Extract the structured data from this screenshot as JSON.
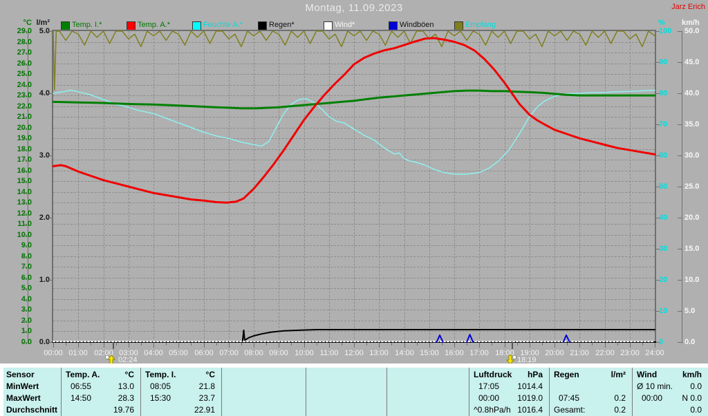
{
  "header": {
    "title": "Montag, 11.09.2023",
    "user": "Jarz Erich"
  },
  "legend": [
    {
      "label": "Temp. I.*",
      "swatch": "#008000",
      "text": "#007800"
    },
    {
      "label": "Temp. A.*",
      "swatch": "#ff0000",
      "text": "#007800"
    },
    {
      "label": "Feuchte A.*",
      "swatch": "#00ffff",
      "text": "#00dede"
    },
    {
      "label": "Regen*",
      "swatch": "#000000",
      "text": "#111111"
    },
    {
      "label": "Wind*",
      "swatch": "#ffffff",
      "text": "#f8f8f8"
    },
    {
      "label": "Windböen",
      "swatch": "#0000d8",
      "text": "#111111"
    },
    {
      "label": "Empfang",
      "swatch": "#7f7f20",
      "text": "#00dede"
    }
  ],
  "x_axis": {
    "labels": [
      "00:00",
      "01:00",
      "02:00",
      "03:00",
      "04:00",
      "05:00",
      "06:00",
      "07:00",
      "08:00",
      "09:00",
      "10:00",
      "11:00",
      "12:00",
      "13:00",
      "14:00",
      "15:00",
      "16:00",
      "17:00",
      "18:00",
      "19:00",
      "20:00",
      "21:00",
      "22:00",
      "23:00",
      "24:00"
    ]
  },
  "markers": [
    {
      "label": "02:24",
      "hour": 2.4,
      "direction": "up"
    },
    {
      "label": "18:19",
      "hour": 18.32,
      "direction": "down"
    }
  ],
  "chart_data": {
    "type": "line",
    "title": "Montag, 11.09.2023",
    "x_unit": "hours",
    "x_range": [
      0,
      24
    ],
    "axes": {
      "temp": {
        "label": "°C",
        "min": 0,
        "max": 29,
        "step": 1,
        "color": "#007800",
        "decimals": 1
      },
      "rain": {
        "label": "l/m²",
        "min": 0,
        "max": 5,
        "step": 1,
        "color": "#1a1a1a",
        "decimals": 1
      },
      "humidity": {
        "label": "%",
        "min": 0,
        "max": 100,
        "step": 10,
        "color": "#00dede",
        "decimals": 0
      },
      "wind": {
        "label": "km/h",
        "min": 0,
        "max": 50,
        "step": 5,
        "color": "#f8f8f8",
        "decimals": 1
      }
    },
    "series": [
      {
        "name": "Empfang",
        "axis": "humidity",
        "color": "#7f7f20",
        "width": 1.5,
        "prefix": [
          [
            0,
            100
          ],
          [
            0.05,
            81
          ],
          [
            0.12,
            100
          ]
        ],
        "sampled": {
          "start": 0.25,
          "step": 0.25,
          "values": [
            100,
            97,
            100,
            99,
            95.5,
            100,
            98,
            100,
            96,
            100,
            100,
            97.5,
            99,
            95,
            100,
            98.5,
            100,
            97,
            100,
            99,
            95.5,
            100,
            98,
            100,
            96,
            100,
            100,
            97.5,
            99,
            95,
            100,
            98.5,
            100,
            97,
            100,
            99,
            95.5,
            100,
            98,
            100,
            96,
            100,
            100,
            97.5,
            99,
            95,
            100,
            98.5,
            100,
            97,
            100,
            99,
            95.5,
            100,
            98,
            100,
            96,
            100,
            100,
            97.5,
            99,
            95,
            100,
            98.5,
            100,
            97,
            100,
            99,
            95.5,
            100,
            98,
            100,
            96,
            100,
            100,
            97.5,
            99,
            95,
            100,
            98.5,
            100,
            97,
            100,
            99,
            95.5,
            100,
            98,
            100,
            96,
            100,
            100,
            97.5,
            99,
            95,
            100,
            98.5
          ]
        }
      },
      {
        "name": "Feuchte A.",
        "axis": "humidity",
        "color": "#8ef2f2",
        "width": 1.5,
        "points": [
          [
            0,
            80
          ],
          [
            0.4,
            80.5
          ],
          [
            0.7,
            81
          ],
          [
            1,
            80.5
          ],
          [
            1.5,
            79.5
          ],
          [
            2,
            78
          ],
          [
            2.5,
            76.5
          ],
          [
            3,
            75.5
          ],
          [
            3.4,
            74.5
          ],
          [
            4,
            73.5
          ],
          [
            4.5,
            72
          ],
          [
            5,
            70.5
          ],
          [
            5.5,
            69
          ],
          [
            6,
            67.5
          ],
          [
            6.5,
            66.3
          ],
          [
            7,
            65.5
          ],
          [
            7.5,
            64.3
          ],
          [
            8,
            63.5
          ],
          [
            8.3,
            63
          ],
          [
            8.6,
            64.5
          ],
          [
            8.9,
            69
          ],
          [
            9.2,
            73.5
          ],
          [
            9.5,
            76.5
          ],
          [
            9.8,
            78
          ],
          [
            10.1,
            78.3
          ],
          [
            10.4,
            77
          ],
          [
            10.7,
            75
          ],
          [
            11,
            72.5
          ],
          [
            11.3,
            71
          ],
          [
            11.6,
            70.5
          ],
          [
            12,
            68.5
          ],
          [
            12.4,
            66.5
          ],
          [
            12.8,
            65
          ],
          [
            13.2,
            62.5
          ],
          [
            13.4,
            61.5
          ],
          [
            13.6,
            60.5
          ],
          [
            13.8,
            60.8
          ],
          [
            14,
            59
          ],
          [
            14.2,
            58.3
          ],
          [
            14.4,
            58
          ],
          [
            14.8,
            57
          ],
          [
            15.2,
            55.5
          ],
          [
            15.6,
            54.5
          ],
          [
            16,
            54
          ],
          [
            16.5,
            54
          ],
          [
            17,
            54.5
          ],
          [
            17.4,
            56
          ],
          [
            17.8,
            58.5
          ],
          [
            18.2,
            62
          ],
          [
            18.6,
            67
          ],
          [
            19,
            72.5
          ],
          [
            19.3,
            75.5
          ],
          [
            19.6,
            77.5
          ],
          [
            20,
            79
          ],
          [
            20.4,
            79.8
          ],
          [
            21,
            80
          ],
          [
            21.5,
            80.2
          ],
          [
            22,
            80.3
          ],
          [
            22.5,
            80.5
          ],
          [
            23,
            80.6
          ],
          [
            23.5,
            80.8
          ],
          [
            24,
            81
          ]
        ]
      },
      {
        "name": "Temp. I.",
        "axis": "temp",
        "color": "#008000",
        "width": 3,
        "points": [
          [
            0,
            22.4
          ],
          [
            1,
            22.35
          ],
          [
            2,
            22.3
          ],
          [
            3,
            22.2
          ],
          [
            4,
            22.15
          ],
          [
            5,
            22.05
          ],
          [
            6,
            21.95
          ],
          [
            6.5,
            21.9
          ],
          [
            7,
            21.85
          ],
          [
            7.5,
            21.8
          ],
          [
            8.1,
            21.8
          ],
          [
            8.6,
            21.85
          ],
          [
            9,
            21.9
          ],
          [
            9.5,
            22.0
          ],
          [
            10,
            22.1
          ],
          [
            10.5,
            22.2
          ],
          [
            11,
            22.3
          ],
          [
            11.5,
            22.4
          ],
          [
            12,
            22.5
          ],
          [
            12.5,
            22.65
          ],
          [
            13,
            22.8
          ],
          [
            13.5,
            22.9
          ],
          [
            14,
            23.0
          ],
          [
            14.5,
            23.1
          ],
          [
            15,
            23.2
          ],
          [
            15.5,
            23.3
          ],
          [
            16,
            23.4
          ],
          [
            16.5,
            23.45
          ],
          [
            17,
            23.45
          ],
          [
            17.5,
            23.4
          ],
          [
            18,
            23.4
          ],
          [
            18.5,
            23.35
          ],
          [
            19,
            23.3
          ],
          [
            19.5,
            23.25
          ],
          [
            20,
            23.15
          ],
          [
            20.5,
            23.05
          ],
          [
            21,
            23.0
          ],
          [
            22,
            23.0
          ],
          [
            23,
            23.0
          ],
          [
            24,
            23.0
          ]
        ]
      },
      {
        "name": "Temp. A.",
        "axis": "temp",
        "color": "#f00000",
        "width": 3,
        "points": [
          [
            0,
            16.4
          ],
          [
            0.3,
            16.5
          ],
          [
            0.5,
            16.4
          ],
          [
            1,
            15.9
          ],
          [
            1.5,
            15.5
          ],
          [
            2,
            15.1
          ],
          [
            2.5,
            14.8
          ],
          [
            3,
            14.5
          ],
          [
            3.5,
            14.2
          ],
          [
            4,
            13.9
          ],
          [
            4.5,
            13.7
          ],
          [
            5,
            13.5
          ],
          [
            5.5,
            13.3
          ],
          [
            6,
            13.2
          ],
          [
            6.5,
            13.05
          ],
          [
            6.92,
            13.0
          ],
          [
            7.3,
            13.1
          ],
          [
            7.6,
            13.4
          ],
          [
            8,
            14.3
          ],
          [
            8.4,
            15.4
          ],
          [
            8.8,
            16.6
          ],
          [
            9.2,
            17.9
          ],
          [
            9.6,
            19.3
          ],
          [
            10,
            20.7
          ],
          [
            10.4,
            21.9
          ],
          [
            10.8,
            23.0
          ],
          [
            11.2,
            24.0
          ],
          [
            11.6,
            24.9
          ],
          [
            12,
            25.9
          ],
          [
            12.4,
            26.5
          ],
          [
            12.8,
            26.9
          ],
          [
            13.2,
            27.2
          ],
          [
            13.6,
            27.4
          ],
          [
            14,
            27.7
          ],
          [
            14.4,
            28.0
          ],
          [
            14.83,
            28.3
          ],
          [
            15.2,
            28.35
          ],
          [
            15.6,
            28.2
          ],
          [
            16,
            28.0
          ],
          [
            16.4,
            27.7
          ],
          [
            16.8,
            27.2
          ],
          [
            17.2,
            26.4
          ],
          [
            17.6,
            25.4
          ],
          [
            18,
            24.2
          ],
          [
            18.3,
            23.2
          ],
          [
            18.6,
            22.2
          ],
          [
            19,
            21.2
          ],
          [
            19.3,
            20.7
          ],
          [
            19.6,
            20.3
          ],
          [
            20,
            19.8
          ],
          [
            20.5,
            19.4
          ],
          [
            21,
            19.0
          ],
          [
            21.5,
            18.7
          ],
          [
            22,
            18.4
          ],
          [
            22.5,
            18.1
          ],
          [
            23,
            17.9
          ],
          [
            23.5,
            17.7
          ],
          [
            24,
            17.5
          ]
        ]
      },
      {
        "name": "Regen",
        "axis": "rain",
        "color": "#000000",
        "width": 2,
        "points": [
          [
            0,
            0
          ],
          [
            7.55,
            0
          ],
          [
            7.6,
            0.19
          ],
          [
            7.64,
            0.03
          ],
          [
            7.8,
            0.07
          ],
          [
            8,
            0.1
          ],
          [
            8.3,
            0.13
          ],
          [
            8.7,
            0.16
          ],
          [
            9.2,
            0.18
          ],
          [
            9.8,
            0.19
          ],
          [
            10.5,
            0.2
          ],
          [
            24,
            0.2
          ]
        ]
      },
      {
        "name": "Wind",
        "axis": "wind",
        "color": "#ffffff",
        "width": 2,
        "dash": "2 3",
        "points": [
          [
            0,
            0.1
          ],
          [
            24,
            0.1
          ]
        ]
      },
      {
        "name": "Windböen",
        "axis": "wind",
        "color": "#0000d8",
        "width": 2,
        "segments": [
          [
            [
              15.3,
              0
            ],
            [
              15.42,
              1.1
            ],
            [
              15.55,
              0
            ]
          ],
          [
            [
              16.5,
              0
            ],
            [
              16.62,
              1.2
            ],
            [
              16.75,
              0
            ]
          ],
          [
            [
              20.35,
              0
            ],
            [
              20.47,
              1.1
            ],
            [
              20.6,
              0
            ]
          ]
        ]
      }
    ]
  },
  "table": {
    "row_labels": [
      "Sensor",
      "MinWert",
      "MaxWert",
      "Durchschnitt"
    ],
    "groups": [
      {
        "name": "Temp. A.",
        "unit": "°C",
        "rows": [
          [
            "06:55",
            "13.0"
          ],
          [
            "14:50",
            "28.3"
          ],
          [
            "",
            "19.76"
          ]
        ]
      },
      {
        "name": "Temp. I.",
        "unit": "°C",
        "rows": [
          [
            "08:05",
            "21.8"
          ],
          [
            "15:30",
            "23.7"
          ],
          [
            "",
            "22.91"
          ]
        ]
      },
      {
        "name": "",
        "unit": "",
        "rows": [
          [
            "",
            ""
          ],
          [
            "",
            ""
          ],
          [
            "",
            ""
          ]
        ]
      },
      {
        "name": "",
        "unit": "",
        "rows": [
          [
            "",
            ""
          ],
          [
            "",
            ""
          ],
          [
            "",
            ""
          ]
        ]
      },
      {
        "name": "",
        "unit": "",
        "rows": [
          [
            "",
            ""
          ],
          [
            "",
            ""
          ],
          [
            "",
            ""
          ]
        ]
      },
      {
        "name": "Luftdruck",
        "unit": "hPa",
        "rows": [
          [
            "17:05",
            "1014.4"
          ],
          [
            "00:00",
            "1019.0"
          ],
          [
            "^0.8hPa/h",
            "1016.4"
          ]
        ]
      },
      {
        "name": "Regen",
        "unit": "l/m²",
        "rows": [
          [
            "",
            ""
          ],
          [
            "07:45",
            "0.2"
          ],
          [
            "Gesamt:",
            "0.2"
          ]
        ]
      },
      {
        "name": "Wind",
        "unit": "km/h",
        "rows": [
          [
            "Ø 10 min.",
            "0.0"
          ],
          [
            "00:00",
            "N 0.0"
          ],
          [
            "",
            "0.0"
          ]
        ]
      }
    ]
  }
}
